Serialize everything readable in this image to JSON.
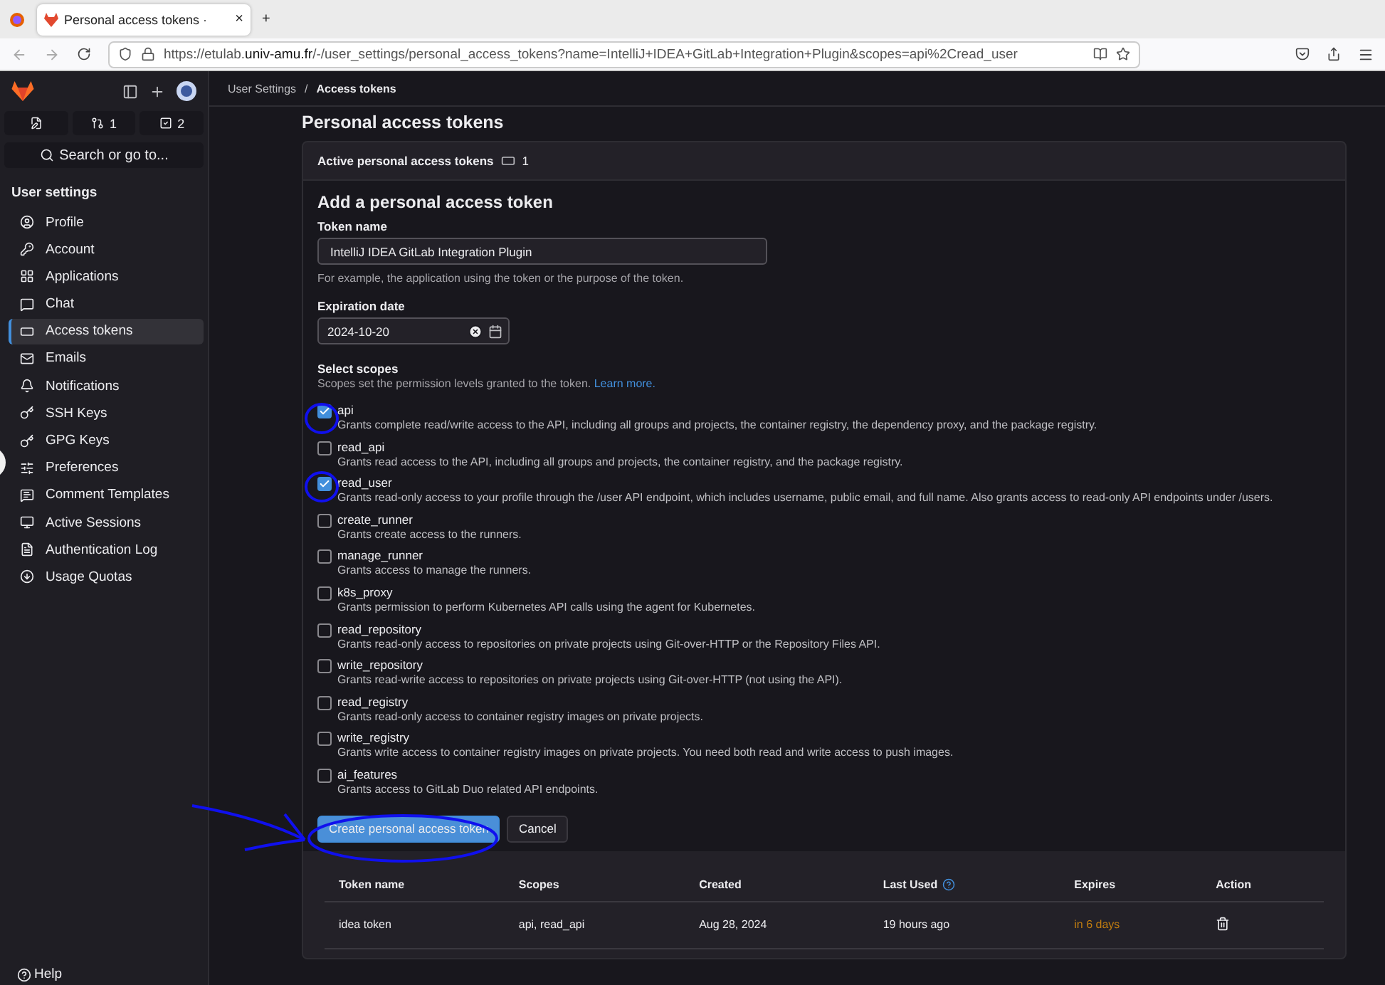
{
  "browser": {
    "tab_title": "Personal access tokens ·",
    "tab_close": "×",
    "new_tab": "+",
    "url": "https://etulab.**univ-amu.fr**/-/user_settings/personal_access_tokens?name=IntelliJ+IDEA+GitLab+Integration+Plugin&scopes=api%2Cread_user"
  },
  "sidebar": {
    "counters": [
      {
        "kind": "edit"
      },
      {
        "kind": "merge_request",
        "count": "1"
      },
      {
        "kind": "todo",
        "count": "2"
      }
    ],
    "search_placeholder": "Search or go to...",
    "section": "User settings",
    "items": [
      {
        "label": "Profile",
        "selected": false
      },
      {
        "label": "Account",
        "selected": false
      },
      {
        "label": "Applications",
        "selected": false
      },
      {
        "label": "Chat",
        "selected": false
      },
      {
        "label": "Access tokens",
        "selected": true
      },
      {
        "label": "Emails",
        "selected": false
      },
      {
        "label": "Notifications",
        "selected": false
      },
      {
        "label": "SSH Keys",
        "selected": false
      },
      {
        "label": "GPG Keys",
        "selected": false
      },
      {
        "label": "Preferences",
        "selected": false
      },
      {
        "label": "Comment Templates",
        "selected": false
      },
      {
        "label": "Active Sessions",
        "selected": false
      },
      {
        "label": "Authentication Log",
        "selected": false
      },
      {
        "label": "Usage Quotas",
        "selected": false
      }
    ],
    "help": "Help"
  },
  "breadcrumb": [
    "User Settings",
    "Access tokens"
  ],
  "breadcrumb_separator": "/",
  "page_title": "Personal access tokens",
  "card": {
    "title": "Active personal access tokens",
    "count": "1"
  },
  "form": {
    "title": "Add a personal access token",
    "token_name_label": "Token name",
    "token_name": "IntelliJ IDEA GitLab Integration Plugin",
    "token_name_hint": "For example, the application using the token or the purpose of the token.",
    "expiration_label": "Expiration date",
    "expiration": "2024-10-20",
    "scopes_label": "Select scopes",
    "scopes_hint": "Scopes set the permission levels granted to the token.",
    "learn_more": "Learn more.",
    "scopes": [
      {
        "name": "api",
        "description": "Grants complete read/write access to the API, including all groups and projects, the container registry, the dependency proxy, and the package registry.",
        "checked": true
      },
      {
        "name": "read_api",
        "description": "Grants read access to the API, including all groups and projects, the container registry, and the package registry.",
        "checked": false
      },
      {
        "name": "read_user",
        "description": "Grants read-only access to your profile through the /user API endpoint, which includes username, public email, and full name. Also grants access to read-only API endpoints under /users.",
        "checked": true
      },
      {
        "name": "create_runner",
        "description": "Grants create access to the runners.",
        "checked": false
      },
      {
        "name": "manage_runner",
        "description": "Grants access to manage the runners.",
        "checked": false
      },
      {
        "name": "k8s_proxy",
        "description": "Grants permission to perform Kubernetes API calls using the agent for Kubernetes.",
        "checked": false
      },
      {
        "name": "read_repository",
        "description": "Grants read-only access to repositories on private projects using Git-over-HTTP or the Repository Files API.",
        "checked": false
      },
      {
        "name": "write_repository",
        "description": "Grants read-write access to repositories on private projects using Git-over-HTTP (not using the API).",
        "checked": false
      },
      {
        "name": "read_registry",
        "description": "Grants read-only access to container registry images on private projects.",
        "checked": false
      },
      {
        "name": "write_registry",
        "description": "Grants write access to container registry images on private projects. You need both read and write access to push images.",
        "checked": false
      },
      {
        "name": "ai_features",
        "description": "Grants access to GitLab Duo related API endpoints.",
        "checked": false
      }
    ],
    "submit": "Create personal access token",
    "cancel": "Cancel"
  },
  "table": {
    "columns": [
      "Token name",
      "Scopes",
      "Created",
      "Last Used",
      "Expires",
      "Action"
    ],
    "rows": [
      {
        "name": "idea token",
        "scopes": "api, read_api",
        "created": "Aug 28, 2024",
        "last_used": "19 hours ago",
        "expires": "in 6 days"
      }
    ]
  }
}
